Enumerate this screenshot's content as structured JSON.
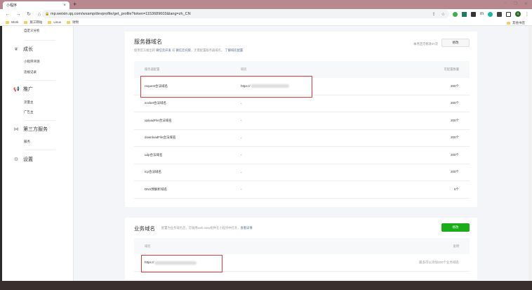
{
  "browser": {
    "tab_title": "小程序",
    "url": "mp.weixin.qq.com/wxamp/devprofile/get_profile?token=1153689603&lang=zh_CN",
    "bookmarks": [
      "Work",
      "施工网站",
      "Linux",
      "财物"
    ],
    "other_bookmarks": "其他书签",
    "profile_initial": "S"
  },
  "sidebar": {
    "items": [
      {
        "label": "自定义分析",
        "type": "sub"
      },
      {
        "label": "成长",
        "type": "head",
        "icon": "growth-icon"
      },
      {
        "label": "小程序评测",
        "type": "sub"
      },
      {
        "label": "违规记录",
        "type": "sub"
      },
      {
        "label": "推广",
        "type": "head",
        "icon": "megaphone-icon"
      },
      {
        "label": "流量主",
        "type": "sub"
      },
      {
        "label": "广告主",
        "type": "sub"
      },
      {
        "label": "第三方服务",
        "type": "head",
        "icon": "third-party-icon"
      },
      {
        "label": "服务",
        "type": "sub"
      },
      {
        "label": "设置",
        "type": "head",
        "icon": "gear-icon"
      }
    ]
  },
  "server_domain": {
    "title": "服务器域名",
    "desc_prefix": "使用官方推出的",
    "link1": "微信云开发",
    "desc_or": "或",
    "link2": "微信云托管",
    "desc_mid": "，无需配置服务器域名。",
    "link3": "了解域名配置",
    "quota": "本月还可修改47次",
    "edit_label": "修改",
    "headers": [
      "服务器配置",
      "域名",
      "可配置数量"
    ],
    "rows": [
      {
        "name": "request合法域名",
        "domain": "https://",
        "count": "200个"
      },
      {
        "name": "socket合法域名",
        "domain": "-",
        "count": "200个"
      },
      {
        "name": "uploadFile合法域名",
        "domain": "-",
        "count": "200个"
      },
      {
        "name": "downloadFile合法域名",
        "domain": "-",
        "count": "200个"
      },
      {
        "name": "udp合法域名",
        "domain": "-",
        "count": "200个"
      },
      {
        "name": "tcp合法域名",
        "domain": "-",
        "count": "200个"
      },
      {
        "name": "DNS预解析域名",
        "domain": "-",
        "count": "5个"
      }
    ]
  },
  "business_domain": {
    "title": "业务域名",
    "desc": "配置为业务域名后，可调用web-view组件在小程序中打开，",
    "link": "查看详情",
    "edit_label": "修改",
    "headers": [
      "域名",
      "说明"
    ],
    "row": {
      "domain": "https://",
      "note": "最多可以添加200个业务域名"
    }
  }
}
